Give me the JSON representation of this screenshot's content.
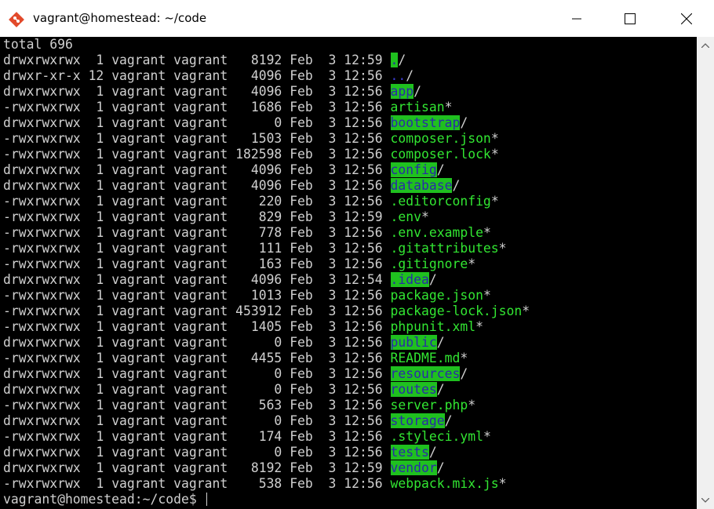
{
  "window": {
    "title": "vagrant@homestead: ~/code",
    "minimize_icon": "minimize-icon",
    "maximize_icon": "maximize-icon",
    "close_icon": "close-icon",
    "app_icon": "git-bash-icon"
  },
  "terminal": {
    "total_line": "total 696",
    "entries": [
      {
        "perm": "drwxrwxrwx",
        "links": "1",
        "owner": "vagrant",
        "group": "vagrant",
        "size": "8192",
        "month": "Feb",
        "day": "3",
        "time": "12:59",
        "name": ".",
        "suffix": "/",
        "kind": "dir"
      },
      {
        "perm": "drwxr-xr-x",
        "links": "12",
        "owner": "vagrant",
        "group": "vagrant",
        "size": "4096",
        "month": "Feb",
        "day": "3",
        "time": "12:56",
        "name": "..",
        "suffix": "/",
        "kind": "parent"
      },
      {
        "perm": "drwxrwxrwx",
        "links": "1",
        "owner": "vagrant",
        "group": "vagrant",
        "size": "4096",
        "month": "Feb",
        "day": "3",
        "time": "12:56",
        "name": "app",
        "suffix": "/",
        "kind": "dir"
      },
      {
        "perm": "-rwxrwxrwx",
        "links": "1",
        "owner": "vagrant",
        "group": "vagrant",
        "size": "1686",
        "month": "Feb",
        "day": "3",
        "time": "12:56",
        "name": "artisan",
        "suffix": "*",
        "kind": "exec"
      },
      {
        "perm": "drwxrwxrwx",
        "links": "1",
        "owner": "vagrant",
        "group": "vagrant",
        "size": "0",
        "month": "Feb",
        "day": "3",
        "time": "12:56",
        "name": "bootstrap",
        "suffix": "/",
        "kind": "dir"
      },
      {
        "perm": "-rwxrwxrwx",
        "links": "1",
        "owner": "vagrant",
        "group": "vagrant",
        "size": "1503",
        "month": "Feb",
        "day": "3",
        "time": "12:56",
        "name": "composer.json",
        "suffix": "*",
        "kind": "exec"
      },
      {
        "perm": "-rwxrwxrwx",
        "links": "1",
        "owner": "vagrant",
        "group": "vagrant",
        "size": "182598",
        "month": "Feb",
        "day": "3",
        "time": "12:56",
        "name": "composer.lock",
        "suffix": "*",
        "kind": "exec"
      },
      {
        "perm": "drwxrwxrwx",
        "links": "1",
        "owner": "vagrant",
        "group": "vagrant",
        "size": "4096",
        "month": "Feb",
        "day": "3",
        "time": "12:56",
        "name": "config",
        "suffix": "/",
        "kind": "dir"
      },
      {
        "perm": "drwxrwxrwx",
        "links": "1",
        "owner": "vagrant",
        "group": "vagrant",
        "size": "4096",
        "month": "Feb",
        "day": "3",
        "time": "12:56",
        "name": "database",
        "suffix": "/",
        "kind": "dir"
      },
      {
        "perm": "-rwxrwxrwx",
        "links": "1",
        "owner": "vagrant",
        "group": "vagrant",
        "size": "220",
        "month": "Feb",
        "day": "3",
        "time": "12:56",
        "name": ".editorconfig",
        "suffix": "*",
        "kind": "exec"
      },
      {
        "perm": "-rwxrwxrwx",
        "links": "1",
        "owner": "vagrant",
        "group": "vagrant",
        "size": "829",
        "month": "Feb",
        "day": "3",
        "time": "12:59",
        "name": ".env",
        "suffix": "*",
        "kind": "exec"
      },
      {
        "perm": "-rwxrwxrwx",
        "links": "1",
        "owner": "vagrant",
        "group": "vagrant",
        "size": "778",
        "month": "Feb",
        "day": "3",
        "time": "12:56",
        "name": ".env.example",
        "suffix": "*",
        "kind": "exec"
      },
      {
        "perm": "-rwxrwxrwx",
        "links": "1",
        "owner": "vagrant",
        "group": "vagrant",
        "size": "111",
        "month": "Feb",
        "day": "3",
        "time": "12:56",
        "name": ".gitattributes",
        "suffix": "*",
        "kind": "exec"
      },
      {
        "perm": "-rwxrwxrwx",
        "links": "1",
        "owner": "vagrant",
        "group": "vagrant",
        "size": "163",
        "month": "Feb",
        "day": "3",
        "time": "12:56",
        "name": ".gitignore",
        "suffix": "*",
        "kind": "exec"
      },
      {
        "perm": "drwxrwxrwx",
        "links": "1",
        "owner": "vagrant",
        "group": "vagrant",
        "size": "4096",
        "month": "Feb",
        "day": "3",
        "time": "12:54",
        "name": ".idea",
        "suffix": "/",
        "kind": "dir"
      },
      {
        "perm": "-rwxrwxrwx",
        "links": "1",
        "owner": "vagrant",
        "group": "vagrant",
        "size": "1013",
        "month": "Feb",
        "day": "3",
        "time": "12:56",
        "name": "package.json",
        "suffix": "*",
        "kind": "exec"
      },
      {
        "perm": "-rwxrwxrwx",
        "links": "1",
        "owner": "vagrant",
        "group": "vagrant",
        "size": "453912",
        "month": "Feb",
        "day": "3",
        "time": "12:56",
        "name": "package-lock.json",
        "suffix": "*",
        "kind": "exec"
      },
      {
        "perm": "-rwxrwxrwx",
        "links": "1",
        "owner": "vagrant",
        "group": "vagrant",
        "size": "1405",
        "month": "Feb",
        "day": "3",
        "time": "12:56",
        "name": "phpunit.xml",
        "suffix": "*",
        "kind": "exec"
      },
      {
        "perm": "drwxrwxrwx",
        "links": "1",
        "owner": "vagrant",
        "group": "vagrant",
        "size": "0",
        "month": "Feb",
        "day": "3",
        "time": "12:56",
        "name": "public",
        "suffix": "/",
        "kind": "dir"
      },
      {
        "perm": "-rwxrwxrwx",
        "links": "1",
        "owner": "vagrant",
        "group": "vagrant",
        "size": "4455",
        "month": "Feb",
        "day": "3",
        "time": "12:56",
        "name": "README.md",
        "suffix": "*",
        "kind": "exec"
      },
      {
        "perm": "drwxrwxrwx",
        "links": "1",
        "owner": "vagrant",
        "group": "vagrant",
        "size": "0",
        "month": "Feb",
        "day": "3",
        "time": "12:56",
        "name": "resources",
        "suffix": "/",
        "kind": "dir"
      },
      {
        "perm": "drwxrwxrwx",
        "links": "1",
        "owner": "vagrant",
        "group": "vagrant",
        "size": "0",
        "month": "Feb",
        "day": "3",
        "time": "12:56",
        "name": "routes",
        "suffix": "/",
        "kind": "dir"
      },
      {
        "perm": "-rwxrwxrwx",
        "links": "1",
        "owner": "vagrant",
        "group": "vagrant",
        "size": "563",
        "month": "Feb",
        "day": "3",
        "time": "12:56",
        "name": "server.php",
        "suffix": "*",
        "kind": "exec"
      },
      {
        "perm": "drwxrwxrwx",
        "links": "1",
        "owner": "vagrant",
        "group": "vagrant",
        "size": "0",
        "month": "Feb",
        "day": "3",
        "time": "12:56",
        "name": "storage",
        "suffix": "/",
        "kind": "dir"
      },
      {
        "perm": "-rwxrwxrwx",
        "links": "1",
        "owner": "vagrant",
        "group": "vagrant",
        "size": "174",
        "month": "Feb",
        "day": "3",
        "time": "12:56",
        "name": ".styleci.yml",
        "suffix": "*",
        "kind": "exec"
      },
      {
        "perm": "drwxrwxrwx",
        "links": "1",
        "owner": "vagrant",
        "group": "vagrant",
        "size": "0",
        "month": "Feb",
        "day": "3",
        "time": "12:56",
        "name": "tests",
        "suffix": "/",
        "kind": "dir"
      },
      {
        "perm": "drwxrwxrwx",
        "links": "1",
        "owner": "vagrant",
        "group": "vagrant",
        "size": "8192",
        "month": "Feb",
        "day": "3",
        "time": "12:59",
        "name": "vendor",
        "suffix": "/",
        "kind": "dir"
      },
      {
        "perm": "-rwxrwxrwx",
        "links": "1",
        "owner": "vagrant",
        "group": "vagrant",
        "size": "538",
        "month": "Feb",
        "day": "3",
        "time": "12:56",
        "name": "webpack.mix.js",
        "suffix": "*",
        "kind": "exec"
      }
    ],
    "prompt": "vagrant@homestead:~/code$ "
  },
  "colors": {
    "background": "#000000",
    "foreground": "#d0d0d0",
    "exec_name": "#32e632",
    "dir_name_text": "#2a2aa8",
    "dir_name_bg": "#1fc01f"
  },
  "scrollbar": {
    "up_icon": "scroll-up-arrow-icon",
    "down_icon": "scroll-down-arrow-icon"
  }
}
